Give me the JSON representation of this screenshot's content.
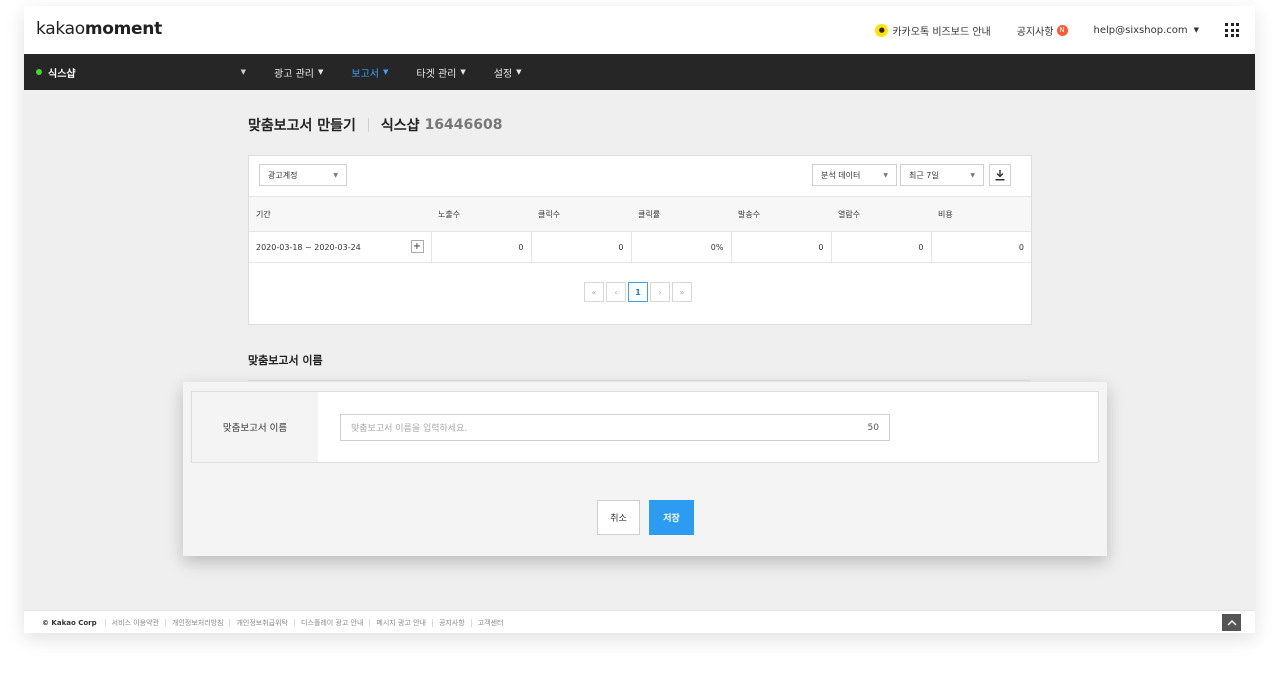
{
  "app": {
    "logo_light": "kakao",
    "logo_bold": "moment"
  },
  "topbar": {
    "biz_board": "카카오톡 비즈보드 안내",
    "notice": "공지사항",
    "notice_badge": "N",
    "user_email": "help@sixshop.com"
  },
  "nav": {
    "account_name": "식스샵",
    "items": [
      {
        "label": "광고 관리"
      },
      {
        "label": "보고서"
      },
      {
        "label": "타겟 관리"
      },
      {
        "label": "설정"
      }
    ],
    "active_index": 1
  },
  "page": {
    "title": "맞춤보고서 만들기",
    "account_name": "식스샵",
    "account_id": "16446608"
  },
  "report": {
    "level_select": "광고계정",
    "data_select": "분석 데이터",
    "period_select": "최근 7일",
    "columns": [
      "기간",
      "노출수",
      "클릭수",
      "클릭률",
      "발송수",
      "열람수",
      "비용"
    ],
    "rows": [
      {
        "period": "2020-03-18 ~ 2020-03-24",
        "values": [
          "0",
          "0",
          "0%",
          "0",
          "0",
          "0"
        ]
      }
    ],
    "pagination": {
      "first": "«",
      "prev": "‹",
      "current": "1",
      "next": "›",
      "last": "»"
    }
  },
  "section": {
    "title": "맞춤보고서 이름"
  },
  "modal": {
    "label": "맞춤보고서 이름",
    "input_placeholder": "맞춤보고서 이름을 입력하세요.",
    "char_limit": "50",
    "cancel_label": "취소",
    "save_label": "저장"
  },
  "footer": {
    "copyright": "© Kakao Corp",
    "links": [
      "서비스 이용약관",
      "개인정보처리방침",
      "개인정보취급위탁",
      "디스플레이 광고 안내",
      "메시지 광고 안내",
      "공지사항",
      "고객센터"
    ]
  },
  "colors": {
    "accent": "#2c9cf2",
    "nav_bg": "#262626",
    "active_nav": "#3aa0f5",
    "status_green": "#4cd137",
    "kakao_yellow": "#fee500",
    "badge_red": "#ff5a36"
  }
}
